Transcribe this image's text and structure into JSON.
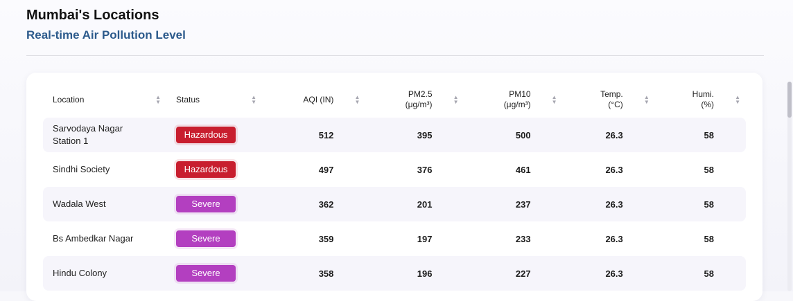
{
  "header": {
    "title": "Mumbai's Locations",
    "subtitle": "Real-time Air Pollution Level"
  },
  "table": {
    "columns": [
      {
        "line1": "Location",
        "line2": ""
      },
      {
        "line1": "Status",
        "line2": ""
      },
      {
        "line1": "AQI (IN)",
        "line2": ""
      },
      {
        "line1": "PM2.5",
        "line2": "(μg/m³)"
      },
      {
        "line1": "PM10",
        "line2": "(μg/m³)"
      },
      {
        "line1": "Temp.",
        "line2": "(°C)"
      },
      {
        "line1": "Humi.",
        "line2": "(%)"
      }
    ],
    "rows": [
      {
        "location_line1": "Sarvodaya Nagar",
        "location_line2": "Station 1",
        "status": "Hazardous",
        "status_color": "#c81e2e",
        "aqi": "512",
        "pm25": "395",
        "pm10": "500",
        "temp": "26.3",
        "humidity": "58"
      },
      {
        "location_line1": "Sindhi Society",
        "location_line2": "",
        "status": "Hazardous",
        "status_color": "#c81e2e",
        "aqi": "497",
        "pm25": "376",
        "pm10": "461",
        "temp": "26.3",
        "humidity": "58"
      },
      {
        "location_line1": "Wadala West",
        "location_line2": "",
        "status": "Severe",
        "status_color": "#b33fc0",
        "aqi": "362",
        "pm25": "201",
        "pm10": "237",
        "temp": "26.3",
        "humidity": "58"
      },
      {
        "location_line1": "Bs Ambedkar Nagar",
        "location_line2": "",
        "status": "Severe",
        "status_color": "#b33fc0",
        "aqi": "359",
        "pm25": "197",
        "pm10": "233",
        "temp": "26.3",
        "humidity": "58"
      },
      {
        "location_line1": "Hindu Colony",
        "location_line2": "",
        "status": "Severe",
        "status_color": "#b33fc0",
        "aqi": "358",
        "pm25": "196",
        "pm10": "227",
        "temp": "26.3",
        "humidity": "58"
      }
    ]
  }
}
